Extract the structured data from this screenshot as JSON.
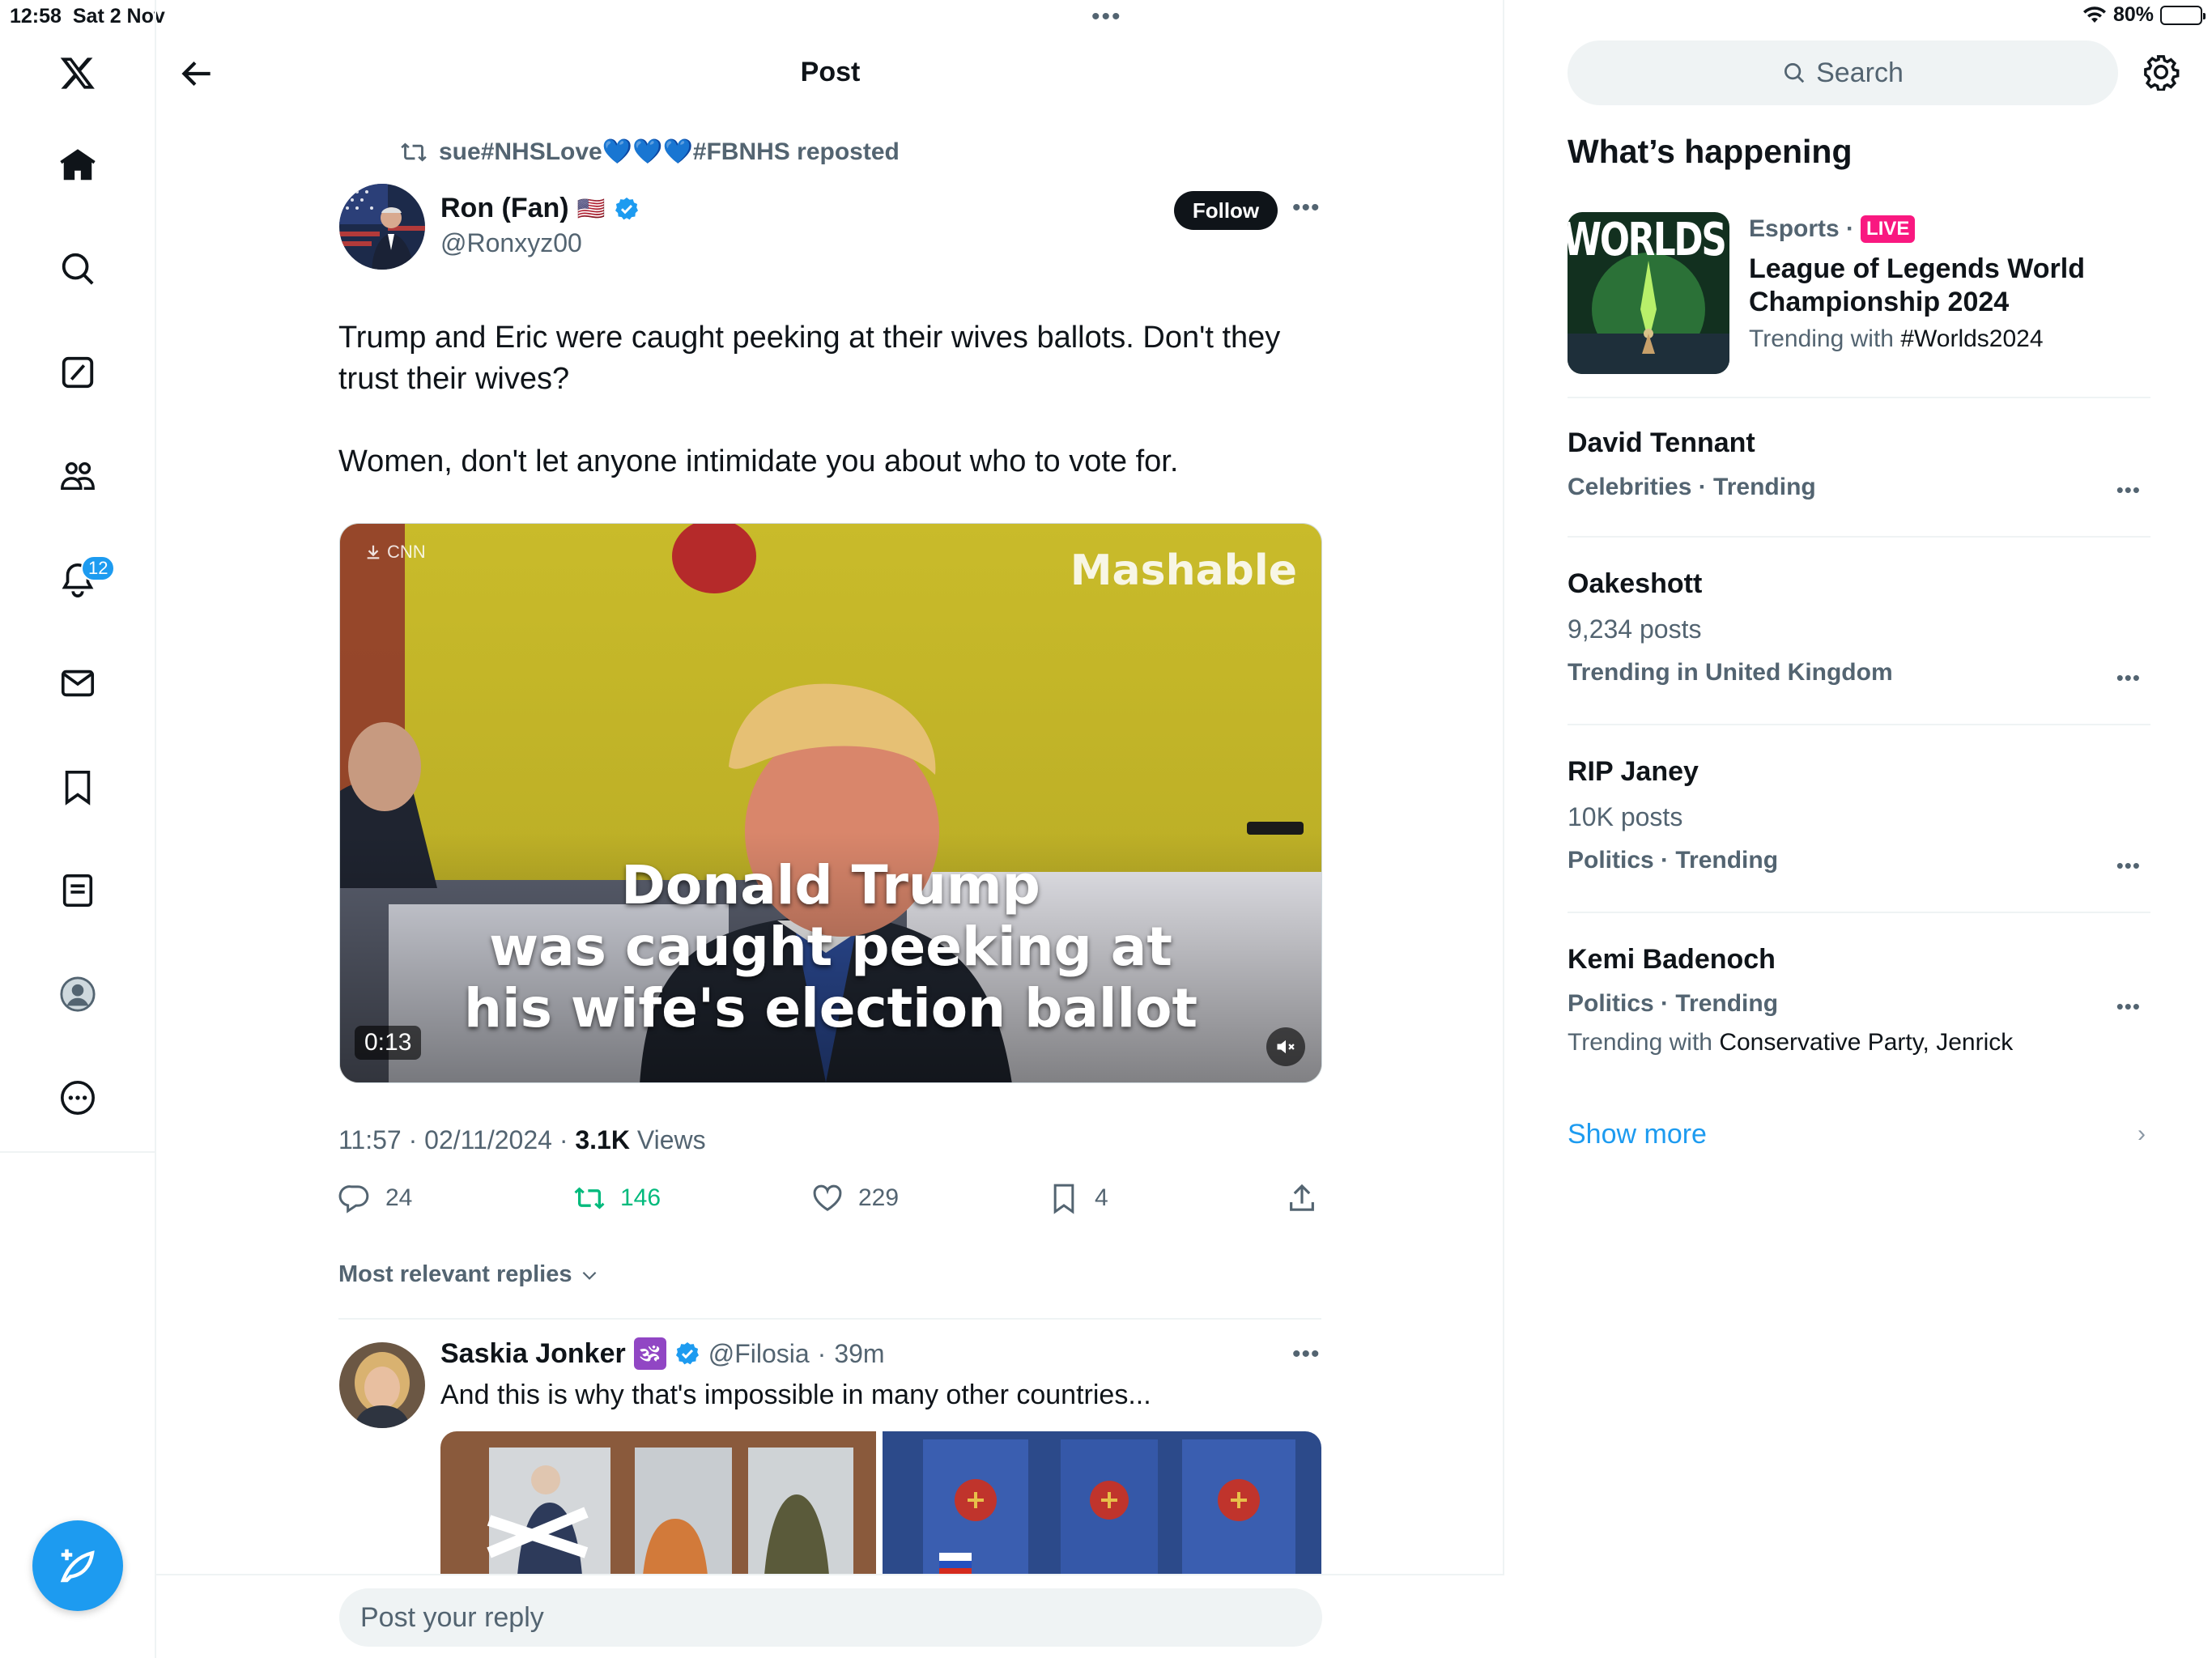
{
  "status": {
    "time": "12:58",
    "date": "Sat 2 Nov",
    "battery": "80%",
    "battery_level": 0.8
  },
  "nav": {
    "items": [
      {
        "name": "x-logo"
      },
      {
        "name": "home"
      },
      {
        "name": "explore"
      },
      {
        "name": "grok"
      },
      {
        "name": "communities"
      },
      {
        "name": "notifications"
      },
      {
        "name": "messages"
      },
      {
        "name": "bookmarks"
      },
      {
        "name": "lists"
      },
      {
        "name": "profile"
      },
      {
        "name": "more"
      }
    ],
    "notification_count": "12"
  },
  "header": {
    "title": "Post"
  },
  "post": {
    "reposted_by": "sue#NHSLove💙💙💙#FBNHS reposted",
    "author_name": "Ron (Fan)",
    "author_flag": "🇺🇸",
    "author_handle": "@Ronxyz00",
    "follow_label": "Follow",
    "text": "Trump and Eric were caught peeking at their wives ballots. Don't they trust their wives?\n\nWomen, don't let anyone intimidate you about who to vote for.",
    "media": {
      "source_label": "CNN",
      "brand": "Mashable",
      "caption_line1": "Donald Trump",
      "caption_line2": "was caught peeking at",
      "caption_line3": "his wife's election ballot",
      "duration": "0:13"
    },
    "time": "11:57",
    "date": "02/11/2024",
    "views_count": "3.1K",
    "views_label": "Views",
    "replies": "24",
    "reposts": "146",
    "likes": "229",
    "bookmarks": "4"
  },
  "replies_filter": "Most relevant replies",
  "reply": {
    "name": "Saskia Jonker",
    "badge": "🕉",
    "handle": "@Filosia",
    "age": "39m",
    "text": "And this is why that's impossible in many other countries..."
  },
  "reply_box": {
    "placeholder": "Post your reply"
  },
  "sidebar": {
    "search_placeholder": "Search",
    "section_title": "What’s happening",
    "featured": {
      "category": "Esports",
      "live": "LIVE",
      "title_line1": "League of Legends World",
      "title_line2": "Championship 2024",
      "trending_with_label": "Trending with",
      "trending_with": "#Worlds2024",
      "thumb_text": "WORLDS"
    },
    "trends": [
      {
        "name": "David Tennant",
        "context": "Celebrities · Trending"
      },
      {
        "name": "Oakeshott",
        "count": "9,234 posts",
        "context": "Trending in United Kingdom"
      },
      {
        "name": "RIP Janey",
        "count": "10K posts",
        "context": "Politics · Trending"
      },
      {
        "name": "Kemi Badenoch",
        "context": "Politics · Trending",
        "trending_with_label": "Trending with",
        "trending_with": "Conservative Party, Jenrick"
      }
    ],
    "show_more": "Show more"
  }
}
